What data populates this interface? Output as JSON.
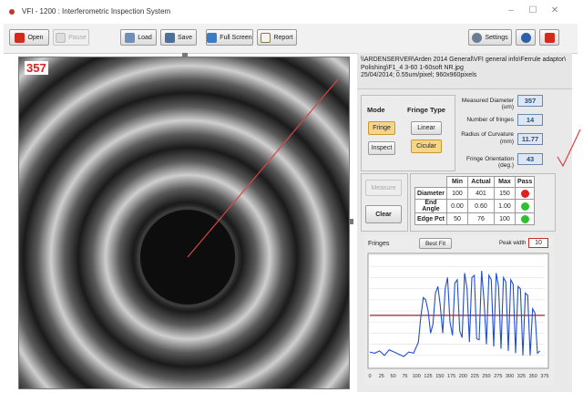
{
  "window": {
    "title": "VFI - 1200 : Interferometric Inspection System",
    "controls": [
      "–",
      "☐",
      "✕"
    ]
  },
  "toolbar": {
    "open": "Open",
    "pause": "Pause",
    "load": "Load",
    "save": "Save",
    "full_screen": "Full Screen",
    "report": "Report",
    "settings": "Settings"
  },
  "image": {
    "overlay_value": "357"
  },
  "file_info": {
    "path_line1": "\\\\ARDENSERVER\\Arden 2014 General\\VFI general info\\Ferrule adaptor\\",
    "path_line2": "Polishing\\F1_4 3-60 1-60soft NR.jpg",
    "meta_line": "25/04/2014; 0.55um/pixel; 960x960pixels"
  },
  "mode": {
    "title": "Mode",
    "fringe": "Fringe",
    "inspect": "Inspect"
  },
  "fringe_type": {
    "title": "Fringe Type",
    "linear": "Linear",
    "circular": "Cicular"
  },
  "measurements": [
    {
      "label": "Measured Diameter (um)",
      "value": "357"
    },
    {
      "label": "Number of fringes",
      "value": "14"
    },
    {
      "label": "Radius of Curvature (mm)",
      "value": "11.77"
    },
    {
      "label": "Fringe Orientation (deg.)",
      "value": "43"
    }
  ],
  "actions": {
    "measure": "Measure",
    "clear": "Clear"
  },
  "results": {
    "headers": [
      "",
      "Min",
      "Actual",
      "Max",
      "Pass"
    ],
    "rows": [
      {
        "name": "Diameter",
        "min": "100",
        "actual": "401",
        "max": "150",
        "pass": "fail"
      },
      {
        "name": "End Angle",
        "min": "0.00",
        "actual": "0.60",
        "max": "1.00",
        "pass": "pass"
      },
      {
        "name": "Edge Pct",
        "min": "50",
        "actual": "76",
        "max": "100",
        "pass": "pass"
      }
    ],
    "status_colors": {
      "pass": "#2fbf2f",
      "fail": "#e02020"
    }
  },
  "plot": {
    "title": "Fringes",
    "best_fit": "Best Fit",
    "peak_width_label": "Peak width",
    "peak_width_value": "10"
  },
  "chart_data": {
    "type": "line",
    "xlim": [
      0,
      360
    ],
    "ylim": [
      0,
      100
    ],
    "x_ticks": [
      "0",
      "25",
      "50",
      "75",
      "100",
      "125",
      "150",
      "175",
      "200",
      "225",
      "250",
      "275",
      "300",
      "325",
      "350",
      "375"
    ],
    "threshold": 46,
    "colors": {
      "signal": "#1f4fd1",
      "threshold": "#9b2335"
    },
    "x": [
      0,
      10,
      20,
      30,
      40,
      50,
      60,
      70,
      80,
      90,
      100,
      105,
      110,
      115,
      120,
      125,
      130,
      135,
      140,
      145,
      150,
      155,
      160,
      165,
      170,
      175,
      180,
      185,
      190,
      195,
      200,
      205,
      210,
      215,
      220,
      225,
      230,
      235,
      240,
      245,
      250,
      255,
      260,
      265,
      270,
      275,
      280,
      285,
      290,
      295,
      300,
      305,
      310,
      315,
      320,
      325,
      330,
      335,
      340,
      345,
      350
    ],
    "y": [
      13,
      12,
      14,
      10,
      15,
      13,
      11,
      9,
      13,
      12,
      22,
      45,
      62,
      60,
      50,
      30,
      38,
      66,
      72,
      55,
      30,
      70,
      80,
      40,
      28,
      75,
      78,
      32,
      26,
      84,
      70,
      22,
      80,
      82,
      25,
      24,
      86,
      60,
      20,
      82,
      78,
      18,
      84,
      72,
      16,
      80,
      76,
      14,
      78,
      74,
      12,
      72,
      70,
      10,
      66,
      64,
      10,
      52,
      48,
      12,
      14
    ]
  }
}
